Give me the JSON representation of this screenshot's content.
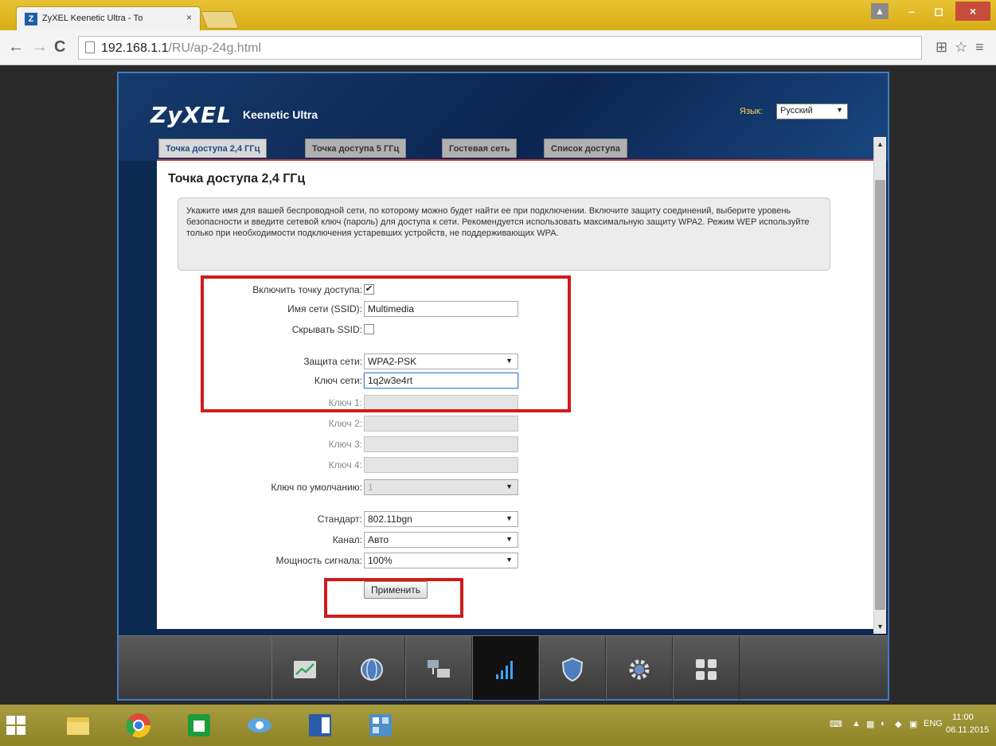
{
  "browser": {
    "tab_title": "ZyXEL Keenetic Ultra - То",
    "tab_close": "×",
    "favicon": "Z",
    "url_host": "192.168.1.1",
    "url_path": "/RU/ap-24g.html",
    "back": "←",
    "forward": "→",
    "reload": "C",
    "translate": "⊞",
    "star": "☆",
    "menu": "≡",
    "user": "▲",
    "minimize": "–",
    "maximize": "◻",
    "close": "×"
  },
  "router": {
    "logo": "ZyXEL",
    "model": "Keenetic Ultra",
    "language_label": "Язык:",
    "language_value": "Русский",
    "tabs": [
      {
        "label": "Точка доступа 2,4 ГГц",
        "active": true
      },
      {
        "label": "Точка доступа 5 ГГц",
        "active": false
      },
      {
        "label": "Гостевая сеть",
        "active": false
      },
      {
        "label": "Список доступа",
        "active": false
      }
    ],
    "page_title": "Точка доступа 2,4 ГГц",
    "info_text": "Укажите имя для вашей беспроводной сети, по которому можно будет найти ее при подключении. Включите защиту соединений, выберите уровень безопасности и введите сетевой ключ (пароль) для доступа к сети. Рекомендуется использовать максимальную защиту WPA2. Режим WEP используйте только при необходимости подключения устаревших устройств, не поддерживающих WPA.",
    "form": {
      "enable_ap_label": "Включить точку доступа:",
      "enable_ap_checked": true,
      "ssid_label": "Имя сети (SSID):",
      "ssid_value": "Multimedia",
      "hide_ssid_label": "Скрывать SSID:",
      "hide_ssid_checked": false,
      "security_label": "Защита сети:",
      "security_value": "WPA2-PSK",
      "key_label": "Ключ сети:",
      "key_value": "1q2w3e4rt",
      "key1_label": "Ключ 1:",
      "key2_label": "Ключ 2:",
      "key3_label": "Ключ 3:",
      "key4_label": "Ключ 4:",
      "default_key_label": "Ключ по умолчанию:",
      "default_key_value": "1",
      "standard_label": "Стандарт:",
      "standard_value": "802.11bgn",
      "channel_label": "Канал:",
      "channel_value": "Авто",
      "power_label": "Мощность сигнала:",
      "power_value": "100%",
      "apply_label": "Применить"
    },
    "dock": [
      "status-icon",
      "internet-globe-icon",
      "home-network-icon",
      "wifi-icon",
      "security-shield-icon",
      "system-gear-icon",
      "apps-grid-icon"
    ],
    "dock_active": 3
  },
  "taskbar": {
    "lang": "ENG",
    "time": "11:00",
    "date": "06.11.2015"
  },
  "colors": {
    "accent_red": "#d11a1a",
    "header_blue": "#0d2a52"
  }
}
